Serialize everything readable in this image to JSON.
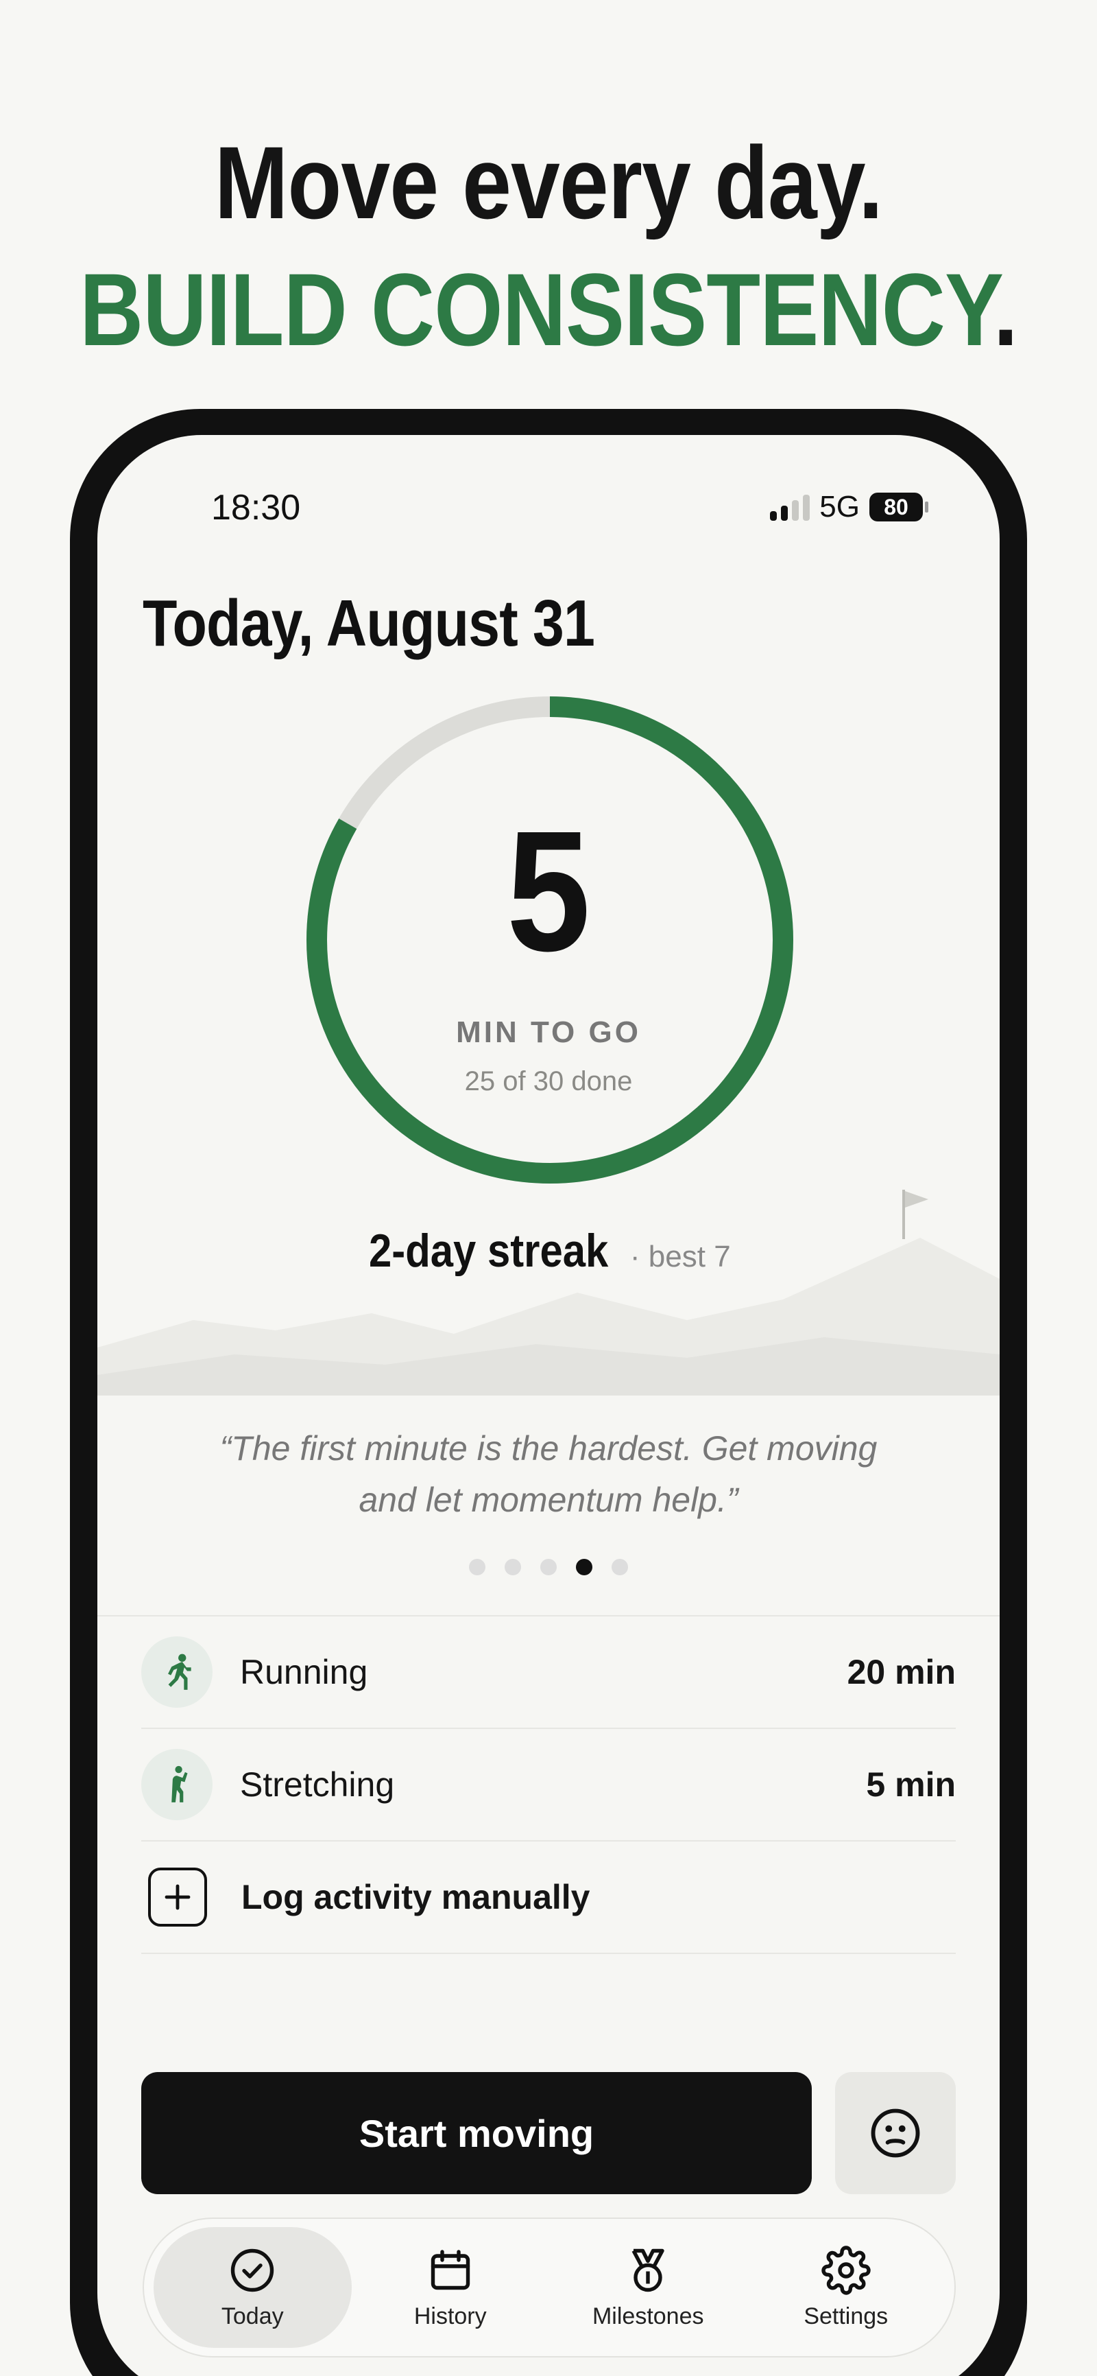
{
  "headline": {
    "line1": "Move every day.",
    "line2": "BUILD CONSISTENCY",
    "line2_dot": "."
  },
  "status_bar": {
    "time": "18:30",
    "network": "5G",
    "battery": "80"
  },
  "today": {
    "title": "Today, August 31",
    "minutes_to_go": "5",
    "min_label": "MIN TO GO",
    "done_text": "25 of 30 done",
    "progress_fraction": 0.833
  },
  "streak": {
    "main": "2-day streak",
    "best": "· best 7"
  },
  "quote": {
    "text": "“The first minute is the hardest. Get moving and let momentum help.”",
    "page_dots": 5,
    "active_dot": 4
  },
  "activities": [
    {
      "icon": "running-icon",
      "label": "Running",
      "value": "20 min"
    },
    {
      "icon": "stretching-icon",
      "label": "Stretching",
      "value": "5 min"
    }
  ],
  "manual": {
    "label": "Log activity manually",
    "icon": "plus-icon"
  },
  "actions": {
    "start_label": "Start moving",
    "mood_icon": "neutral-face-icon"
  },
  "tabs": [
    {
      "label": "Today",
      "icon": "check-circle-icon",
      "active": true
    },
    {
      "label": "History",
      "icon": "calendar-icon",
      "active": false
    },
    {
      "label": "Milestones",
      "icon": "medal-icon",
      "active": false
    },
    {
      "label": "Settings",
      "icon": "gear-icon",
      "active": false
    }
  ],
  "colors": {
    "accent_green": "#2d7a45",
    "ring_track": "#dcdcd8",
    "background": "#f7f7f4"
  }
}
